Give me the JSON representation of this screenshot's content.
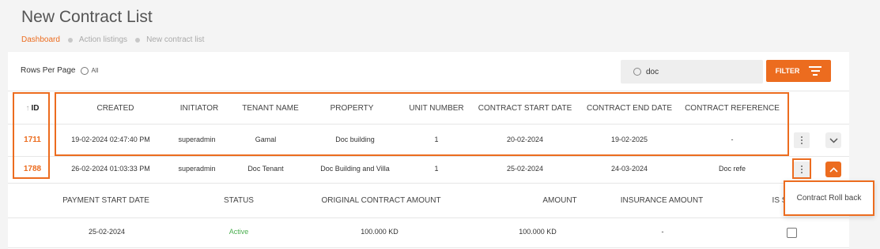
{
  "page": {
    "title": "New Contract List",
    "breadcrumb": [
      "Dashboard",
      "Action listings",
      "New contract list"
    ]
  },
  "toolbar": {
    "rows_per_page_label": "Rows Per Page",
    "rows_all_label": "All",
    "search_value": "doc",
    "filter_label": "FILTER"
  },
  "table": {
    "headers": {
      "id": "ID",
      "created": "CREATED",
      "initiator": "INITIATOR",
      "tenant_name": "TENANT NAME",
      "property": "PROPERTY",
      "unit_number": "UNIT NUMBER",
      "contract_start_date": "CONTRACT START DATE",
      "contract_end_date": "CONTRACT END DATE",
      "contract_reference": "CONTRACT REFERENCE"
    },
    "rows": [
      {
        "id": "1711",
        "created": "19-02-2024 02:47:40 PM",
        "initiator": "superadmin",
        "tenant_name": "Gamal",
        "property": "Doc building",
        "unit_number": "1",
        "contract_start_date": "20-02-2024",
        "contract_end_date": "19-02-2025",
        "contract_reference": "-"
      },
      {
        "id": "1788",
        "created": "26-02-2024 01:03:33 PM",
        "initiator": "superadmin",
        "tenant_name": "Doc Tenant",
        "property": "Doc Building and Villa",
        "unit_number": "1",
        "contract_start_date": "25-02-2024",
        "contract_end_date": "24-03-2024",
        "contract_reference": "Doc refe"
      }
    ]
  },
  "details": {
    "headers": {
      "payment_start_date": "PAYMENT START DATE",
      "status": "STATUS",
      "original_contract_amount": "ORIGINAL CONTRACT AMOUNT",
      "amount": "AMOUNT",
      "insurance_amount": "INSURANCE AMOUNT",
      "is_s": "IS S"
    },
    "row": {
      "payment_start_date": "25-02-2024",
      "status": "Active",
      "original_contract_amount": "100.000 KD",
      "amount": "100.000 KD",
      "insurance_amount": "-"
    }
  },
  "popup_menu": {
    "item": "Contract Roll back"
  },
  "icons": {
    "sort": "arrow-up-icon",
    "search": "search-icon",
    "filter": "filter-lines-icon",
    "kebab": "kebab-menu-icon",
    "expand": "chevron-down-icon",
    "collapse": "chevron-up-icon"
  },
  "colors": {
    "accent": "#ec6c1f",
    "status_active": "#4caf50"
  }
}
